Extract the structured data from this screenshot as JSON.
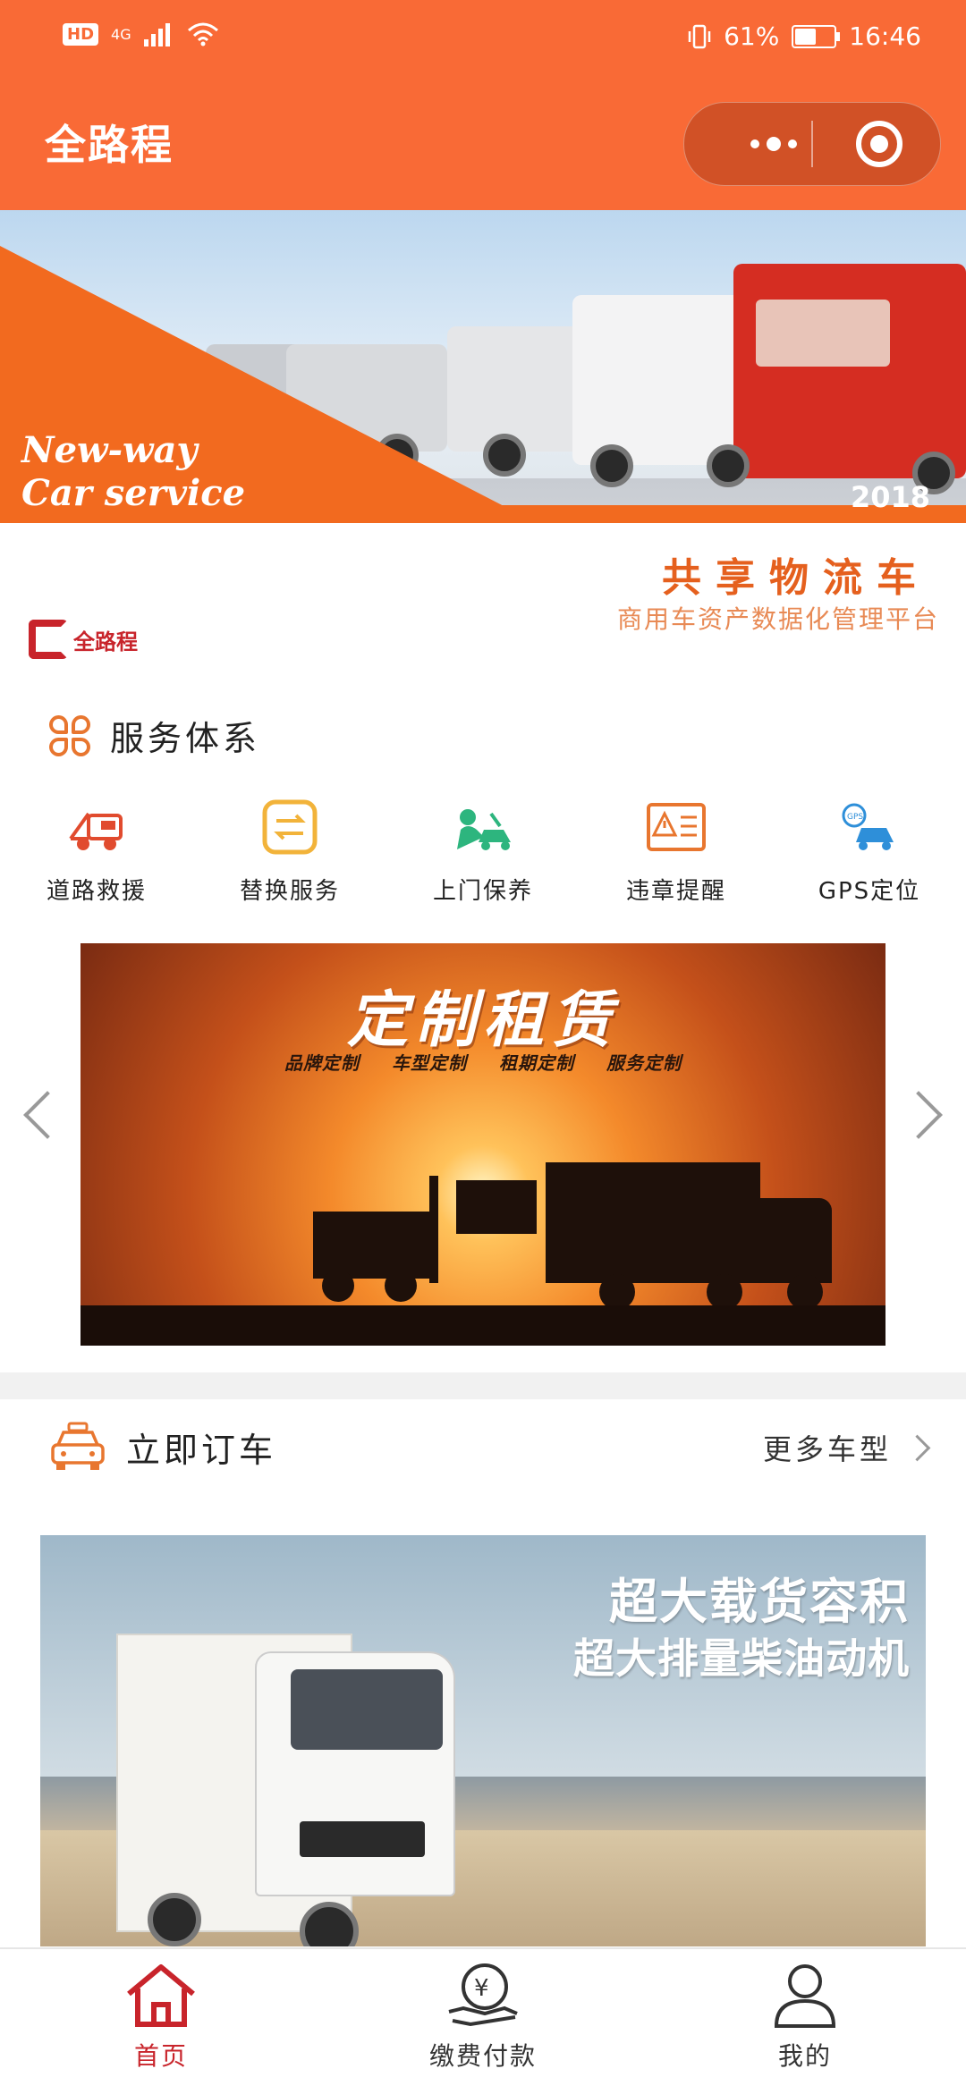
{
  "status_bar": {
    "hd": "HD",
    "network": "4G",
    "battery_percent": "61%",
    "battery_level": 0.61,
    "time": "16:46"
  },
  "header": {
    "title": "全路程"
  },
  "banner": {
    "slogan_line1": "New-way",
    "slogan_line2": "Car service",
    "year": "2018",
    "cn_title": "共享物流车",
    "cn_subtitle": "商用车资产数据化管理平台",
    "logo_text": "全路程"
  },
  "services": {
    "title": "服务体系",
    "items": [
      {
        "label": "道路救援",
        "icon": "tow-truck-icon",
        "color": "#E14B2E"
      },
      {
        "label": "替换服务",
        "icon": "swap-icon",
        "color": "#F2B33A"
      },
      {
        "label": "上门保养",
        "icon": "car-maintenance-icon",
        "color": "#2DB57E"
      },
      {
        "label": "违章提醒",
        "icon": "violation-card-icon",
        "color": "#E8762F"
      },
      {
        "label": "GPS定位",
        "icon": "gps-car-icon",
        "color": "#2E8FD9"
      }
    ]
  },
  "lease_banner": {
    "title": "定制租赁",
    "tags": [
      "品牌定制",
      "车型定制",
      "租期定制",
      "服务定制"
    ]
  },
  "booking": {
    "title": "立即订车",
    "more_label": "更多车型",
    "promo_line1": "超大载货容积",
    "promo_line2": "超大排量柴油动机"
  },
  "tabbar": {
    "items": [
      {
        "label": "首页",
        "icon": "home-icon",
        "active": true
      },
      {
        "label": "缴费付款",
        "icon": "payment-icon",
        "active": false
      },
      {
        "label": "我的",
        "icon": "profile-icon",
        "active": false
      }
    ]
  },
  "colors": {
    "brand_orange": "#F96A36",
    "active_red": "#C8242B"
  }
}
